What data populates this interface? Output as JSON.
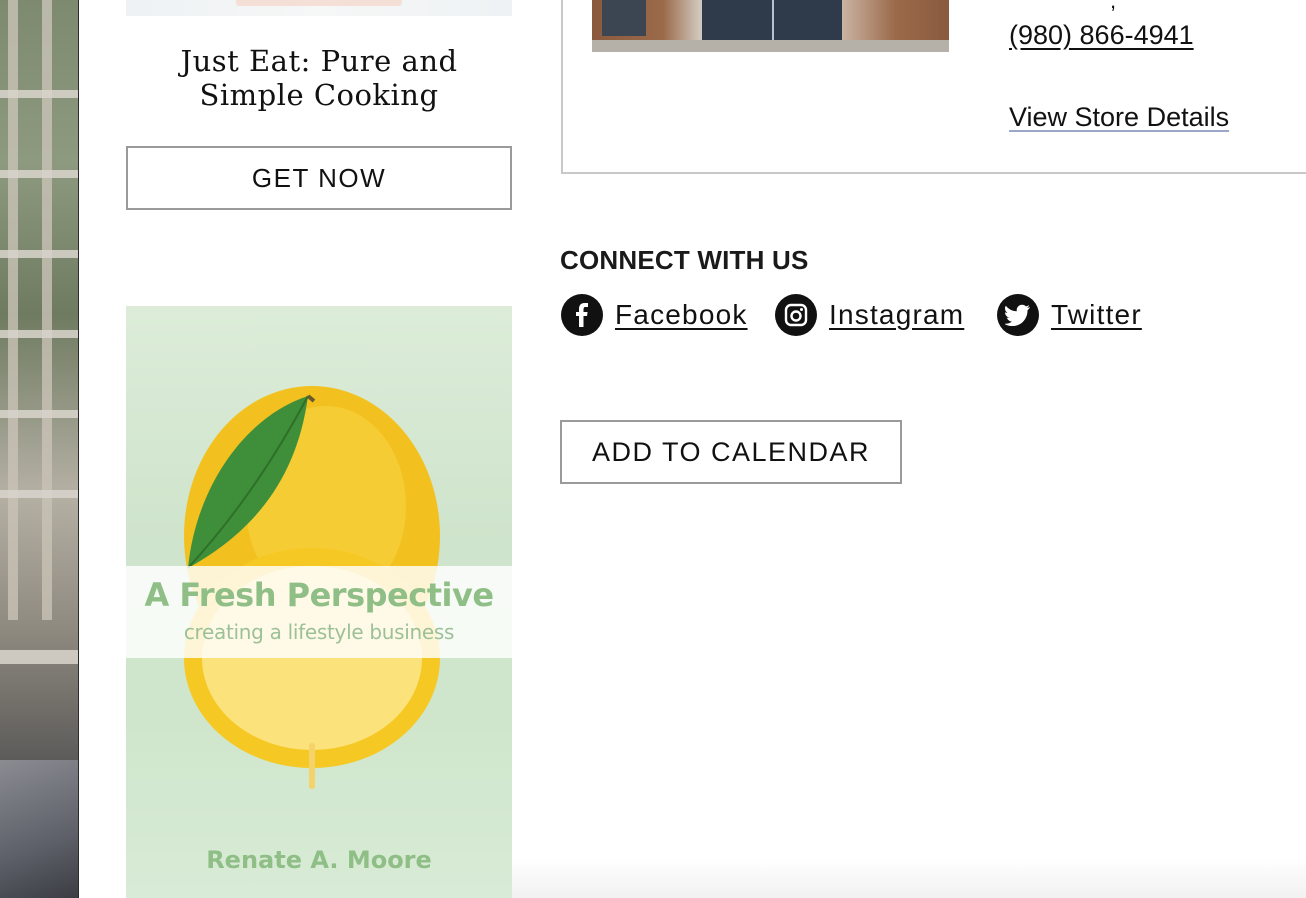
{
  "left_panel": {
    "book_title": "Just Eat: Pure and Simple Cooking",
    "get_now_label": "GET NOW",
    "cover": {
      "title": "A Fresh Perspective",
      "subtitle": "creating a lifestyle business",
      "author": "Renate A. Moore"
    }
  },
  "store": {
    "phone": "(980) 866-4941",
    "details_link": "View Store Details"
  },
  "connect": {
    "heading": "CONNECT WITH US",
    "links": [
      {
        "label": "Facebook",
        "icon": "facebook-icon"
      },
      {
        "label": "Instagram",
        "icon": "instagram-icon"
      },
      {
        "label": "Twitter",
        "icon": "twitter-icon"
      }
    ]
  },
  "calendar": {
    "button_label": "ADD TO CALENDAR"
  },
  "colors": {
    "text": "#1a1a1a",
    "button_border": "#9a9a9a",
    "cover_green": "#8fbf86"
  }
}
